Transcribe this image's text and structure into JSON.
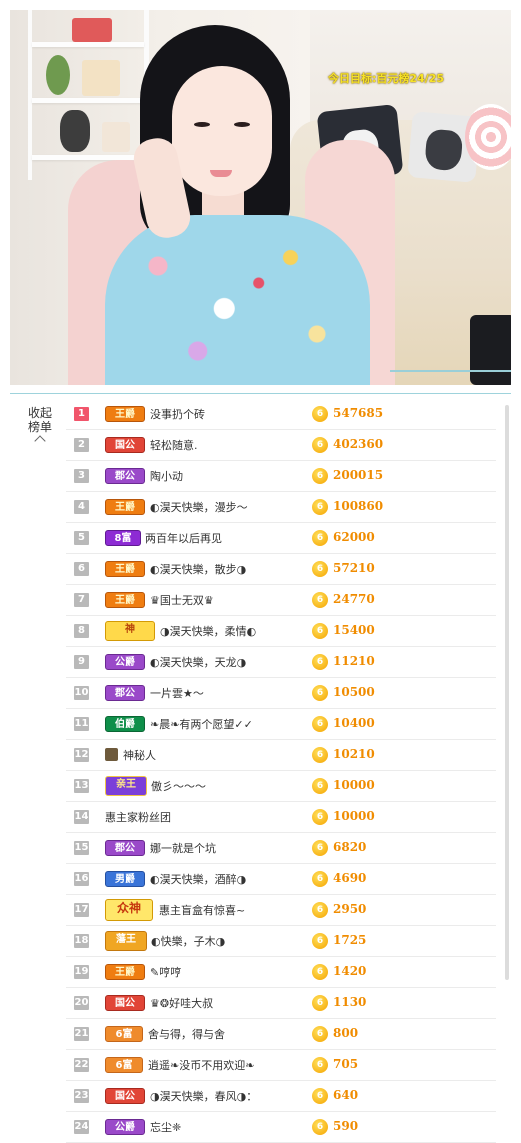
{
  "video": {
    "overlay_text": "今日目标:百元榜24/25"
  },
  "rank_panel": {
    "collapse_label_line1": "收起",
    "collapse_label_line2": "榜单",
    "rows": [
      {
        "rank": "1",
        "badge": "王爵",
        "badge_style": "wang",
        "name": "没事扔个砖",
        "score": "547685"
      },
      {
        "rank": "2",
        "badge": "国公",
        "badge_style": "gong",
        "name": "轻松随意.",
        "score": "402360"
      },
      {
        "rank": "3",
        "badge": "郡公",
        "badge_style": "gong2",
        "name": "陶小动",
        "score": "200015"
      },
      {
        "rank": "4",
        "badge": "王爵",
        "badge_style": "wang",
        "name": "◐淏天快樂，漫步～",
        "score": "100860"
      },
      {
        "rank": "5",
        "badge": "8富",
        "badge_style": "fu8",
        "name": "两百年以后再见",
        "score": "62000"
      },
      {
        "rank": "6",
        "badge": "王爵",
        "badge_style": "wang",
        "name": "◐淏天快樂，散步◑",
        "score": "57210"
      },
      {
        "rank": "7",
        "badge": "王爵",
        "badge_style": "wang",
        "name": "♛国士无双♛",
        "score": "24770"
      },
      {
        "rank": "8",
        "badge": "神",
        "badge_style": "shen",
        "name": "◑淏天快樂，柔情◐",
        "score": "15400"
      },
      {
        "rank": "9",
        "badge": "公爵",
        "badge_style": "gong2",
        "name": "◐淏天快樂，天龙◑",
        "score": "11210"
      },
      {
        "rank": "10",
        "badge": "郡公",
        "badge_style": "gong2",
        "name": "一片雲★～",
        "score": "10500"
      },
      {
        "rank": "11",
        "badge": "伯爵",
        "badge_style": "fu",
        "name": "❧晨❧有两个愿望✓✓",
        "score": "10400"
      },
      {
        "rank": "12",
        "badge": "",
        "badge_style": "avatar",
        "name": "神秘人",
        "score": "10210"
      },
      {
        "rank": "13",
        "badge": "亲王",
        "badge_style": "qin",
        "name": "傲彡～～～",
        "score": "10000"
      },
      {
        "rank": "14",
        "badge": "",
        "badge_style": "none",
        "name": "惠主家粉丝团",
        "score": "10000"
      },
      {
        "rank": "15",
        "badge": "郡公",
        "badge_style": "gong2",
        "name": "娜一就是个坑",
        "score": "6820"
      },
      {
        "rank": "16",
        "badge": "男爵",
        "badge_style": "nan",
        "name": "◐淏天快樂，酒醉◑",
        "score": "4690"
      },
      {
        "rank": "17",
        "badge": "众神",
        "badge_style": "zhong",
        "name": "惠主盲盒有惊喜~",
        "score": "2950"
      },
      {
        "rank": "18",
        "badge": "藩王",
        "badge_style": "fan",
        "name": "◐快樂，子木◑",
        "score": "1725"
      },
      {
        "rank": "19",
        "badge": "王爵",
        "badge_style": "wang",
        "name": "✎哼哼",
        "score": "1420"
      },
      {
        "rank": "20",
        "badge": "国公",
        "badge_style": "gong",
        "name": "♛❂好哇大叔",
        "score": "1130"
      },
      {
        "rank": "21",
        "badge": "6富",
        "badge_style": "fu6",
        "name": "舍与得，得与舍",
        "score": "800"
      },
      {
        "rank": "22",
        "badge": "6富",
        "badge_style": "fu6",
        "name": "逍遥❧没币不用欢迎❧",
        "score": "705"
      },
      {
        "rank": "23",
        "badge": "国公",
        "badge_style": "gong",
        "name": "◑淏天快樂，春风◑：",
        "score": "640"
      },
      {
        "rank": "24",
        "badge": "公爵",
        "badge_style": "gong2",
        "name": "忘尘❈",
        "score": "590"
      }
    ],
    "coin_glyph": "6"
  }
}
